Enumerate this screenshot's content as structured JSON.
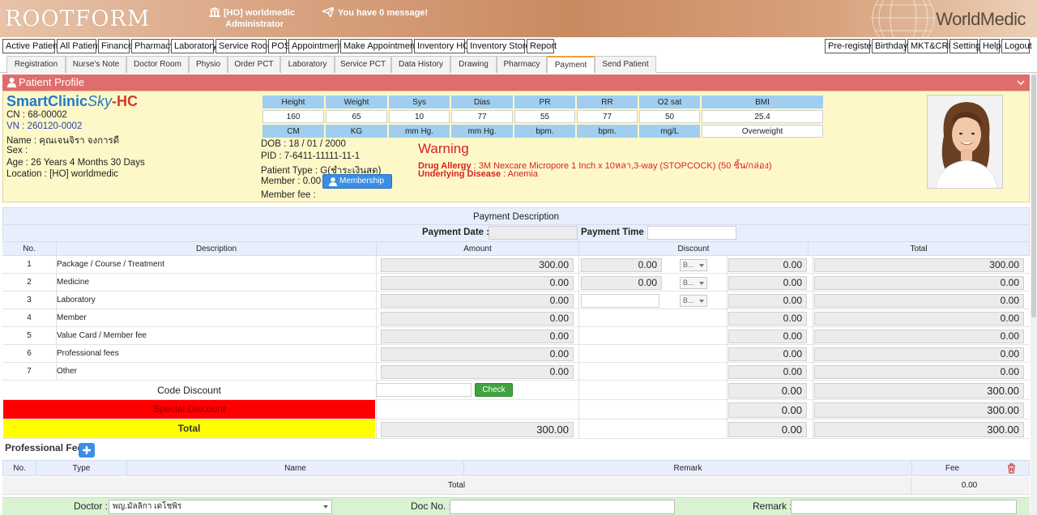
{
  "header": {
    "brand_left": "ROOTFORM",
    "branch": "[HO] worldmedic",
    "role": "Administrator",
    "message": "You have 0 message!",
    "brand_right": "WorldMedic"
  },
  "main_menu": {
    "left": [
      "Active Patient",
      "All Patient",
      "Finance",
      "Pharmacy",
      "Laboratory",
      "Service Room",
      "POS",
      "Appointment",
      "Make Appointment",
      "Inventory HO",
      "Inventory Store",
      "Report"
    ],
    "right": [
      "Pre-register",
      "Birthday",
      "MKT&CRM",
      "Setting",
      "Help",
      "Logout"
    ]
  },
  "tabs": [
    "Registration",
    "Nurse's Note",
    "Doctor Room",
    "Physio",
    "Order PCT",
    "Laboratory",
    "Service PCT",
    "Data History",
    "Drawing",
    "Pharmacy",
    "Payment",
    "Send Patient"
  ],
  "active_tab": "Payment",
  "profile": {
    "section_title": "Patient Profile",
    "logo": {
      "part1": "SmartClinic",
      "part2": "Sky",
      "part3": "-HC"
    },
    "cn": "CN : 68-00002",
    "vn": "VN : 260120-0002",
    "name": "Name : คุณเจนจิรา จงการดี",
    "sex": "Sex :",
    "age": "Age : 26 Years 4 Months 30 Days",
    "location": "Location : [HO] worldmedic",
    "dob": "DOB : 18 / 01 / 2000",
    "pid": "PID : 7-6411-11111-11-1",
    "patient_type": "Patient Type : G(ชำระเงินสด)",
    "member": "Member : 0.00",
    "member_fee": "Member fee :",
    "membership_button": "Membership",
    "vitals": {
      "headers": [
        "Height",
        "Weight",
        "Sys",
        "Dias",
        "PR",
        "RR",
        "O2 sat",
        "BMI"
      ],
      "values": [
        "160",
        "65",
        "10",
        "77",
        "55",
        "77",
        "50",
        "25.4"
      ],
      "units": [
        "CM",
        "KG",
        "mm Hg.",
        "mm Hg.",
        "bpm.",
        "bpm.",
        "mg/L",
        "Overweight"
      ]
    },
    "warning": {
      "title": "Warning",
      "allergy_label": "Drug Allergy",
      "allergy_value": " : 3M Nexcare Micropore 1 Inch x 10หลา,3-way (STOPCOCK) (50 ชิ้น/กล่อง)",
      "disease_label": "Underlying Disease",
      "disease_value": " : Anemia"
    }
  },
  "payment": {
    "title": "Payment Description",
    "date_label": "Payment Date :",
    "date_value": "",
    "time_label": "Payment Time :",
    "time_value": "",
    "columns": [
      "No.",
      "Description",
      "Amount",
      "Discount",
      "Total"
    ],
    "rows": [
      {
        "no": "1",
        "desc": "Package / Course / Treatment",
        "amount": "300.00",
        "discount": "0.00",
        "dtype": "B...",
        "disc_total": "0.00",
        "total": "300.00"
      },
      {
        "no": "2",
        "desc": "Medicine",
        "amount": "0.00",
        "discount": "0.00",
        "dtype": "B...",
        "disc_total": "0.00",
        "total": "0.00"
      },
      {
        "no": "3",
        "desc": "Laboratory",
        "amount": "0.00",
        "discount": "",
        "dtype": "B...",
        "disc_total": "0.00",
        "total": "0.00"
      },
      {
        "no": "4",
        "desc": "Member",
        "amount": "0.00",
        "disc_total": "0.00",
        "total": "0.00"
      },
      {
        "no": "5",
        "desc": "Value Card / Member fee",
        "amount": "0.00",
        "disc_total": "0.00",
        "total": "0.00"
      },
      {
        "no": "6",
        "desc": "Professional fees",
        "amount": "0.00",
        "disc_total": "0.00",
        "total": "0.00"
      },
      {
        "no": "7",
        "desc": "Other",
        "amount": "0.00",
        "disc_total": "0.00",
        "total": "0.00"
      }
    ],
    "code_discount": {
      "label": "Code Discount",
      "value": "",
      "check_button": "Check",
      "disc_total": "0.00",
      "total": "300.00"
    },
    "special_discount": {
      "label": "Special Discount",
      "disc_total": "0.00",
      "total": "300.00"
    },
    "grand_total": {
      "label": "Total",
      "amount": "300.00",
      "disc_total": "0.00",
      "total": "300.00"
    }
  },
  "professional_fee": {
    "legend": "Professional Fee",
    "columns": [
      "No.",
      "Type",
      "Name",
      "Remark",
      "Fee"
    ],
    "total_label": "Total",
    "total_value": "0.00"
  },
  "doctor_bar": {
    "doctor_label": "Doctor :",
    "doctor_value": "พญ.มัลลิกา เดโชพิร",
    "docno_label": "Doc No. :",
    "docno_value": "",
    "remark_label": "Remark :",
    "remark_value": ""
  },
  "colors": {
    "profile_header": "#e06d6d",
    "profile_bg": "#fef8c8",
    "vitals_header": "#9fcef0",
    "special_discount": "#ff0000",
    "total_row": "#ffff00",
    "check_button": "#3fa33f",
    "warning_text": "#d82020"
  }
}
